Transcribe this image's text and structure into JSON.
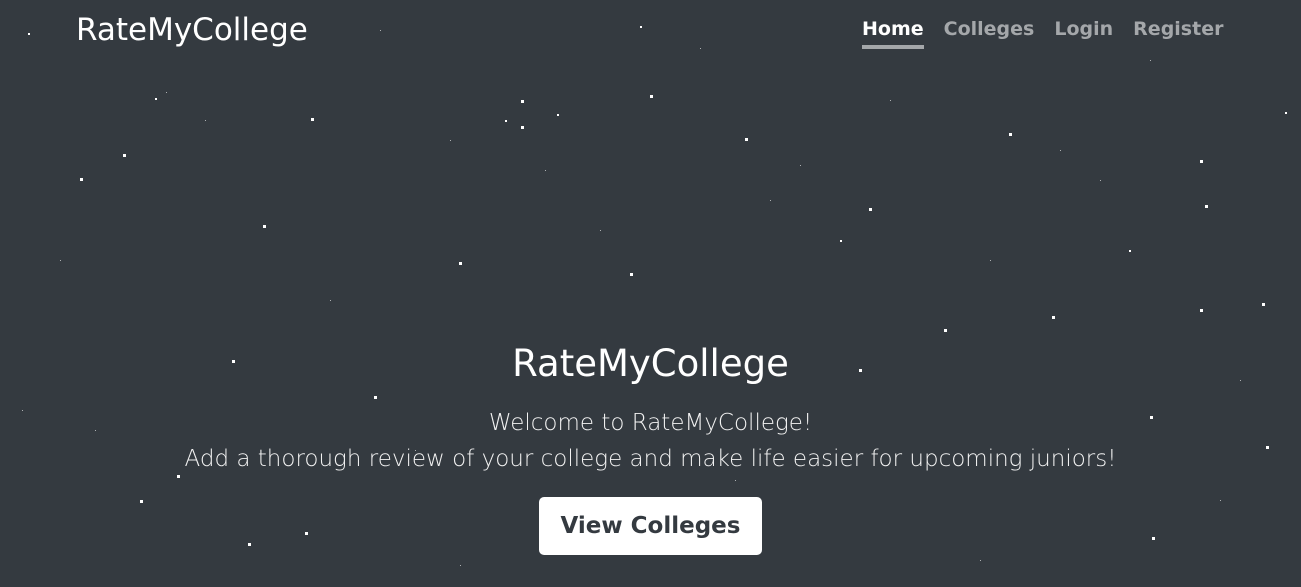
{
  "app": {
    "brand": "RateMyCollege"
  },
  "nav": {
    "items": [
      {
        "label": "Home",
        "active": true
      },
      {
        "label": "Colleges",
        "active": false
      },
      {
        "label": "Login",
        "active": false
      },
      {
        "label": "Register",
        "active": false
      }
    ]
  },
  "hero": {
    "title": "RateMyCollege",
    "line1": "Welcome to RateMyCollege!",
    "line2": "Add a thorough review of your college and make life easier for upcoming juniors!",
    "cta_label": "View Colleges"
  },
  "theme": {
    "background": "#343a40",
    "nav_muted": "#a4a7aa",
    "star": "#ffffff"
  }
}
